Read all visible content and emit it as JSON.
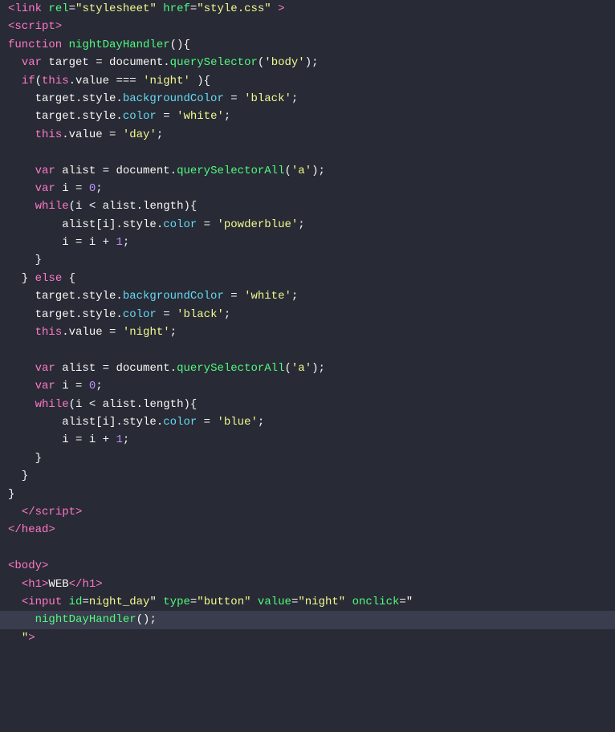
{
  "editor": {
    "background": "#282a36",
    "lines": [
      {
        "id": 1,
        "content": "link_line",
        "highlighted": false
      },
      {
        "id": 2,
        "content": "script_open",
        "highlighted": false
      },
      {
        "id": 3,
        "content": "function_decl",
        "highlighted": false
      },
      {
        "id": 4,
        "content": "var_target",
        "highlighted": false
      },
      {
        "id": 5,
        "content": "if_this",
        "highlighted": false
      },
      {
        "id": 6,
        "content": "target_bg_black",
        "highlighted": false
      },
      {
        "id": 7,
        "content": "target_color_white",
        "highlighted": false
      },
      {
        "id": 8,
        "content": "this_value_day",
        "highlighted": false
      },
      {
        "id": 9,
        "content": "empty1",
        "highlighted": false
      },
      {
        "id": 10,
        "content": "var_alist1",
        "highlighted": false
      },
      {
        "id": 11,
        "content": "var_i1",
        "highlighted": false
      },
      {
        "id": 12,
        "content": "while1",
        "highlighted": false
      },
      {
        "id": 13,
        "content": "alist_color_powderblue",
        "highlighted": false
      },
      {
        "id": 14,
        "content": "i_plus1_1",
        "highlighted": false
      },
      {
        "id": 15,
        "content": "close_while1",
        "highlighted": false
      },
      {
        "id": 16,
        "content": "else_open",
        "highlighted": false
      },
      {
        "id": 17,
        "content": "target_bg_white",
        "highlighted": false
      },
      {
        "id": 18,
        "content": "target_color_black",
        "highlighted": false
      },
      {
        "id": 19,
        "content": "this_value_night",
        "highlighted": false
      },
      {
        "id": 20,
        "content": "empty2",
        "highlighted": false
      },
      {
        "id": 21,
        "content": "var_alist2",
        "highlighted": false
      },
      {
        "id": 22,
        "content": "var_i2",
        "highlighted": false
      },
      {
        "id": 23,
        "content": "while2",
        "highlighted": false
      },
      {
        "id": 24,
        "content": "alist_color_blue",
        "highlighted": false
      },
      {
        "id": 25,
        "content": "i_plus1_2",
        "highlighted": false
      },
      {
        "id": 26,
        "content": "close_while2",
        "highlighted": false
      },
      {
        "id": 27,
        "content": "close_else",
        "highlighted": false
      },
      {
        "id": 28,
        "content": "close_function",
        "highlighted": false
      },
      {
        "id": 29,
        "content": "script_close",
        "highlighted": false
      },
      {
        "id": 30,
        "content": "head_close",
        "highlighted": false
      },
      {
        "id": 31,
        "content": "empty3",
        "highlighted": false
      },
      {
        "id": 32,
        "content": "body_open",
        "highlighted": false
      },
      {
        "id": 33,
        "content": "h1_line",
        "highlighted": false
      },
      {
        "id": 34,
        "content": "input_line",
        "highlighted": false
      },
      {
        "id": 35,
        "content": "handler_call",
        "highlighted": true
      },
      {
        "id": 36,
        "content": "quote_close",
        "highlighted": false
      }
    ]
  }
}
